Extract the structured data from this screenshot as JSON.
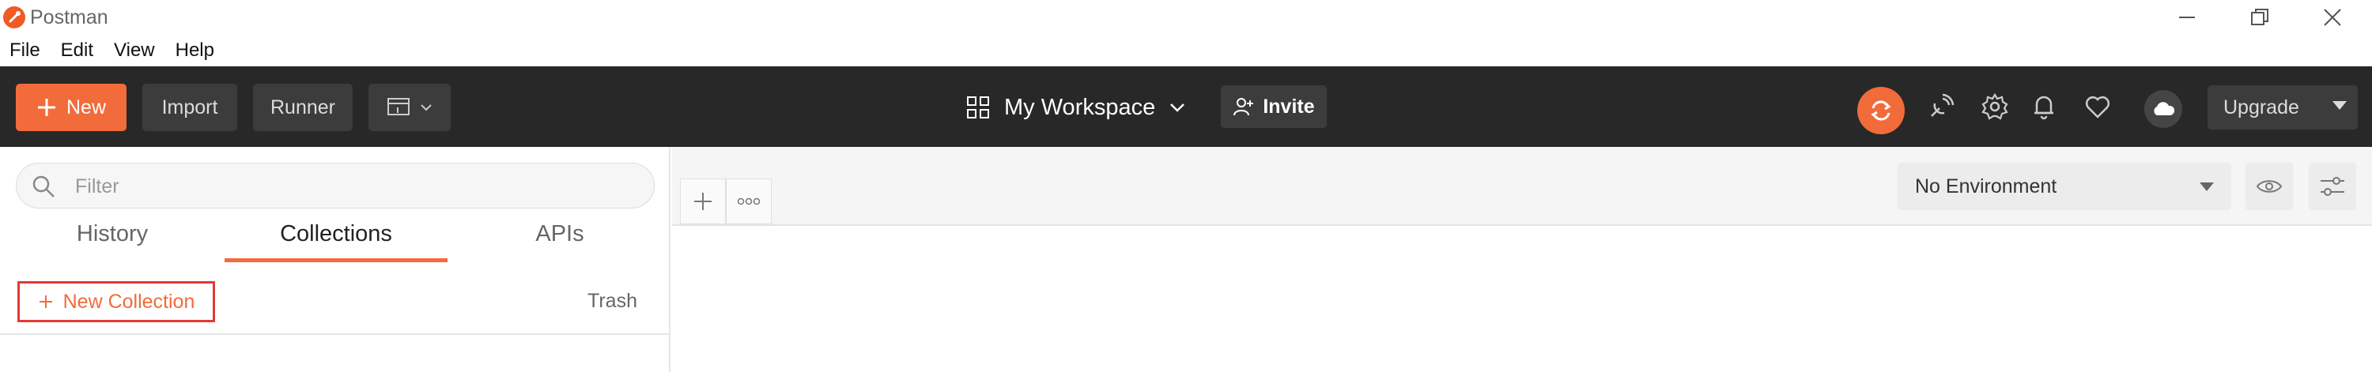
{
  "app": {
    "title": "Postman"
  },
  "menu": [
    "File",
    "Edit",
    "View",
    "Help"
  ],
  "header": {
    "new_label": "New",
    "import_label": "Import",
    "runner_label": "Runner",
    "workspace_label": "My Workspace",
    "invite_label": "Invite",
    "upgrade_label": "Upgrade",
    "accent_color": "#f26b3a"
  },
  "sidebar": {
    "filter_placeholder": "Filter",
    "tabs": [
      {
        "label": "History"
      },
      {
        "label": "Collections",
        "active": true
      },
      {
        "label": "APIs"
      }
    ],
    "new_collection_label": "New Collection",
    "trash_label": "Trash"
  },
  "main": {
    "environment": "No Environment"
  }
}
